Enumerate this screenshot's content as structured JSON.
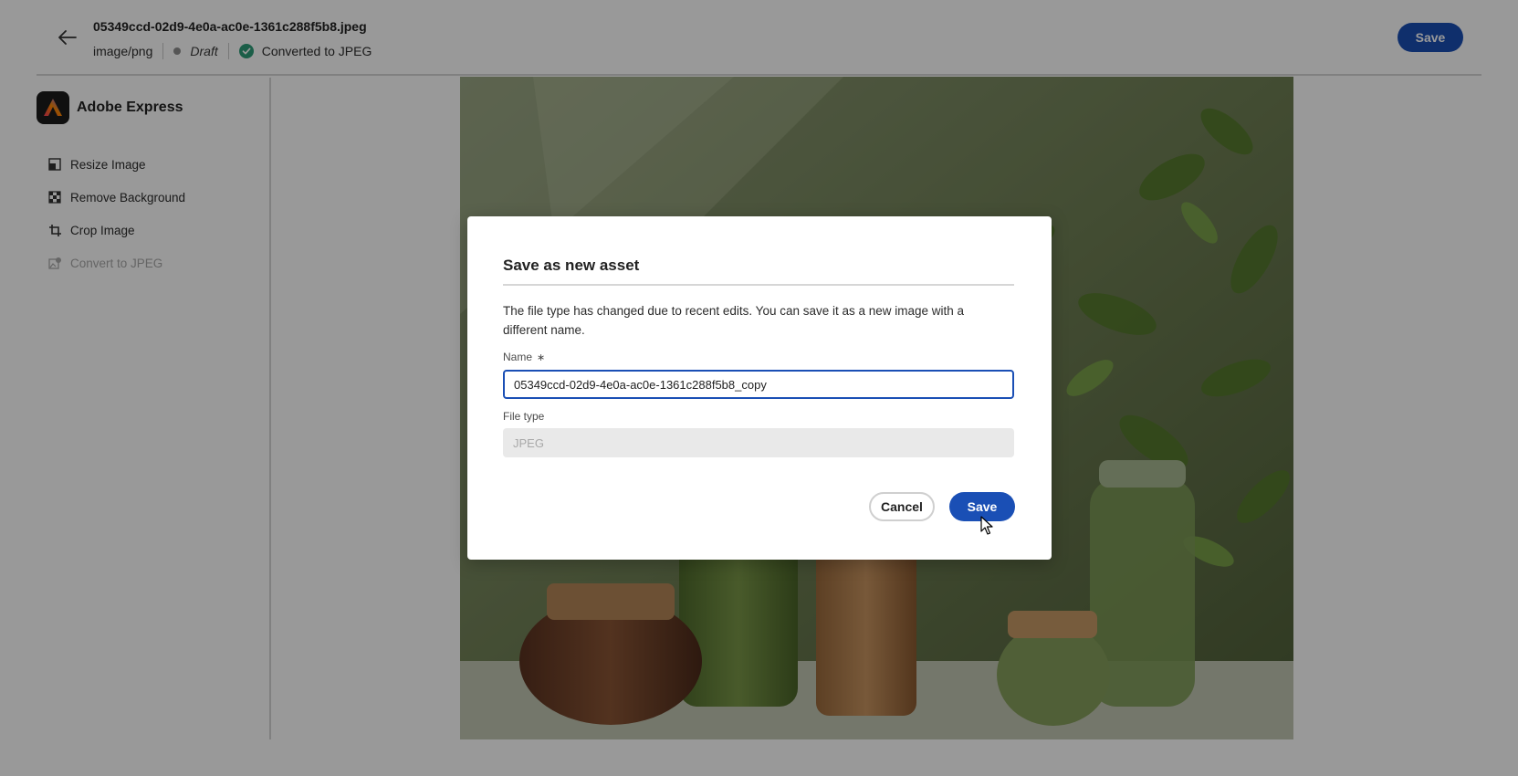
{
  "header": {
    "file_name": "05349ccd-02d9-4e0a-ac0e-1361c288f5b8.jpeg",
    "mime_type": "image/png",
    "status": "Draft",
    "conversion": "Converted to JPEG",
    "save_label": "Save"
  },
  "sidebar": {
    "brand": "Adobe Express",
    "tools": [
      {
        "label": "Resize Image",
        "icon": "resize-icon",
        "enabled": true
      },
      {
        "label": "Remove Background",
        "icon": "remove-background-icon",
        "enabled": true
      },
      {
        "label": "Crop Image",
        "icon": "crop-icon",
        "enabled": true
      },
      {
        "label": "Convert to JPEG",
        "icon": "convert-icon",
        "enabled": false
      }
    ]
  },
  "dialog": {
    "title": "Save as new asset",
    "description": "The file type has changed due to recent edits. You can save it as a new image with a different name.",
    "name_label": "Name",
    "required_marker": "∗",
    "name_value": "05349ccd-02d9-4e0a-ac0e-1361c288f5b8_copy",
    "file_type_label": "File type",
    "file_type_value": "JPEG",
    "cancel_label": "Cancel",
    "save_label": "Save"
  },
  "colors": {
    "accent": "#1a4fb5",
    "success": "#2d9d78",
    "overlay": "rgba(0,0,0,0.40)"
  }
}
